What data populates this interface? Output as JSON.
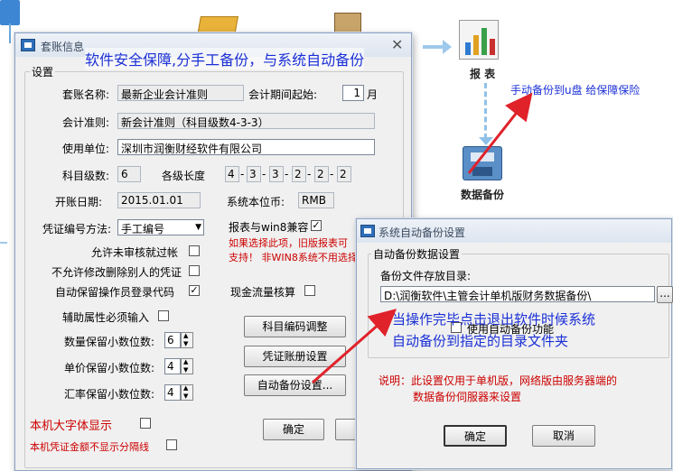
{
  "flow": {
    "report_label": "报 表",
    "backup_label": "数据备份",
    "caption_manual": "手动备份到u盘 给保障保险"
  },
  "annotations": {
    "top": "软件安全保障,分手工备份，与系统自动备份",
    "middle_line1": "当操作完毕点击退出软件时候系统",
    "middle_line2": "自动备份到指定的目录文件夹"
  },
  "main_dialog": {
    "title": "套账信息",
    "group_label": "设置",
    "fields": {
      "account_name_label": "套账名称:",
      "account_name_value": "最新企业会计准则",
      "period_start_label": "会计期间起始:",
      "period_start_value": "1",
      "period_unit": "月",
      "standard_label": "会计准则:",
      "standard_value": "新会计准则（科目级数4-3-3）",
      "unit_label": "使用单位:",
      "unit_value": "深圳市润衡财经软件有限公司",
      "levels_label": "科目级数:",
      "levels_value": "6",
      "level_len_label": "各级长度",
      "level_len_values": [
        "4",
        "3",
        "3",
        "2",
        "2",
        "2"
      ],
      "open_date_label": "开账日期:",
      "open_date_value": "2015.01.01",
      "currency_label": "系统本位币:",
      "currency_value": "RMB",
      "voucher_method_label": "凭证编号方法:",
      "voucher_method_value": "手工编号"
    },
    "checks": {
      "win8_compat": "报表与win8兼容",
      "win8_note_line1": "如果选择此项，旧版报表可",
      "win8_note_line2": "支持！ 非WIN8系统不用选择",
      "allow_unreviewed": "允许未审核就过帐",
      "no_modify_others": "不允许修改删除别人的凭证",
      "auto_save_operator": "自动保留操作员登录代码",
      "cashflow_check": "现金流量核算",
      "aux_required": "辅助属性必须输入",
      "big_font": "本机大字体显示",
      "no_separator": "本机凭证金额不显示分隔线"
    },
    "decimals": {
      "qty_label": "数量保留小数位数:",
      "qty_value": "6",
      "price_label": "单价保留小数位数:",
      "price_value": "4",
      "rate_label": "汇率保留小数位数:",
      "rate_value": "4"
    },
    "buttons": {
      "code_adjust": "科目编码调整",
      "voucher_setup": "凭证账册设置",
      "auto_backup": "自动备份设置...",
      "ok": "确定"
    }
  },
  "backup_dialog": {
    "title": "系统自动备份设置",
    "group_label": "自动备份数据设置",
    "dir_label": "备份文件存放目录:",
    "dir_value": "D:\\润衡软件\\主管会计单机版财务数据备份\\",
    "browse": "...",
    "enable_label": "使用自动备份功能",
    "note_line1": "说明：此设置仅用于单机版，网络版由服务器端的",
    "note_line2": "数据备份伺服器来设置",
    "ok": "确定",
    "cancel": "取消"
  }
}
